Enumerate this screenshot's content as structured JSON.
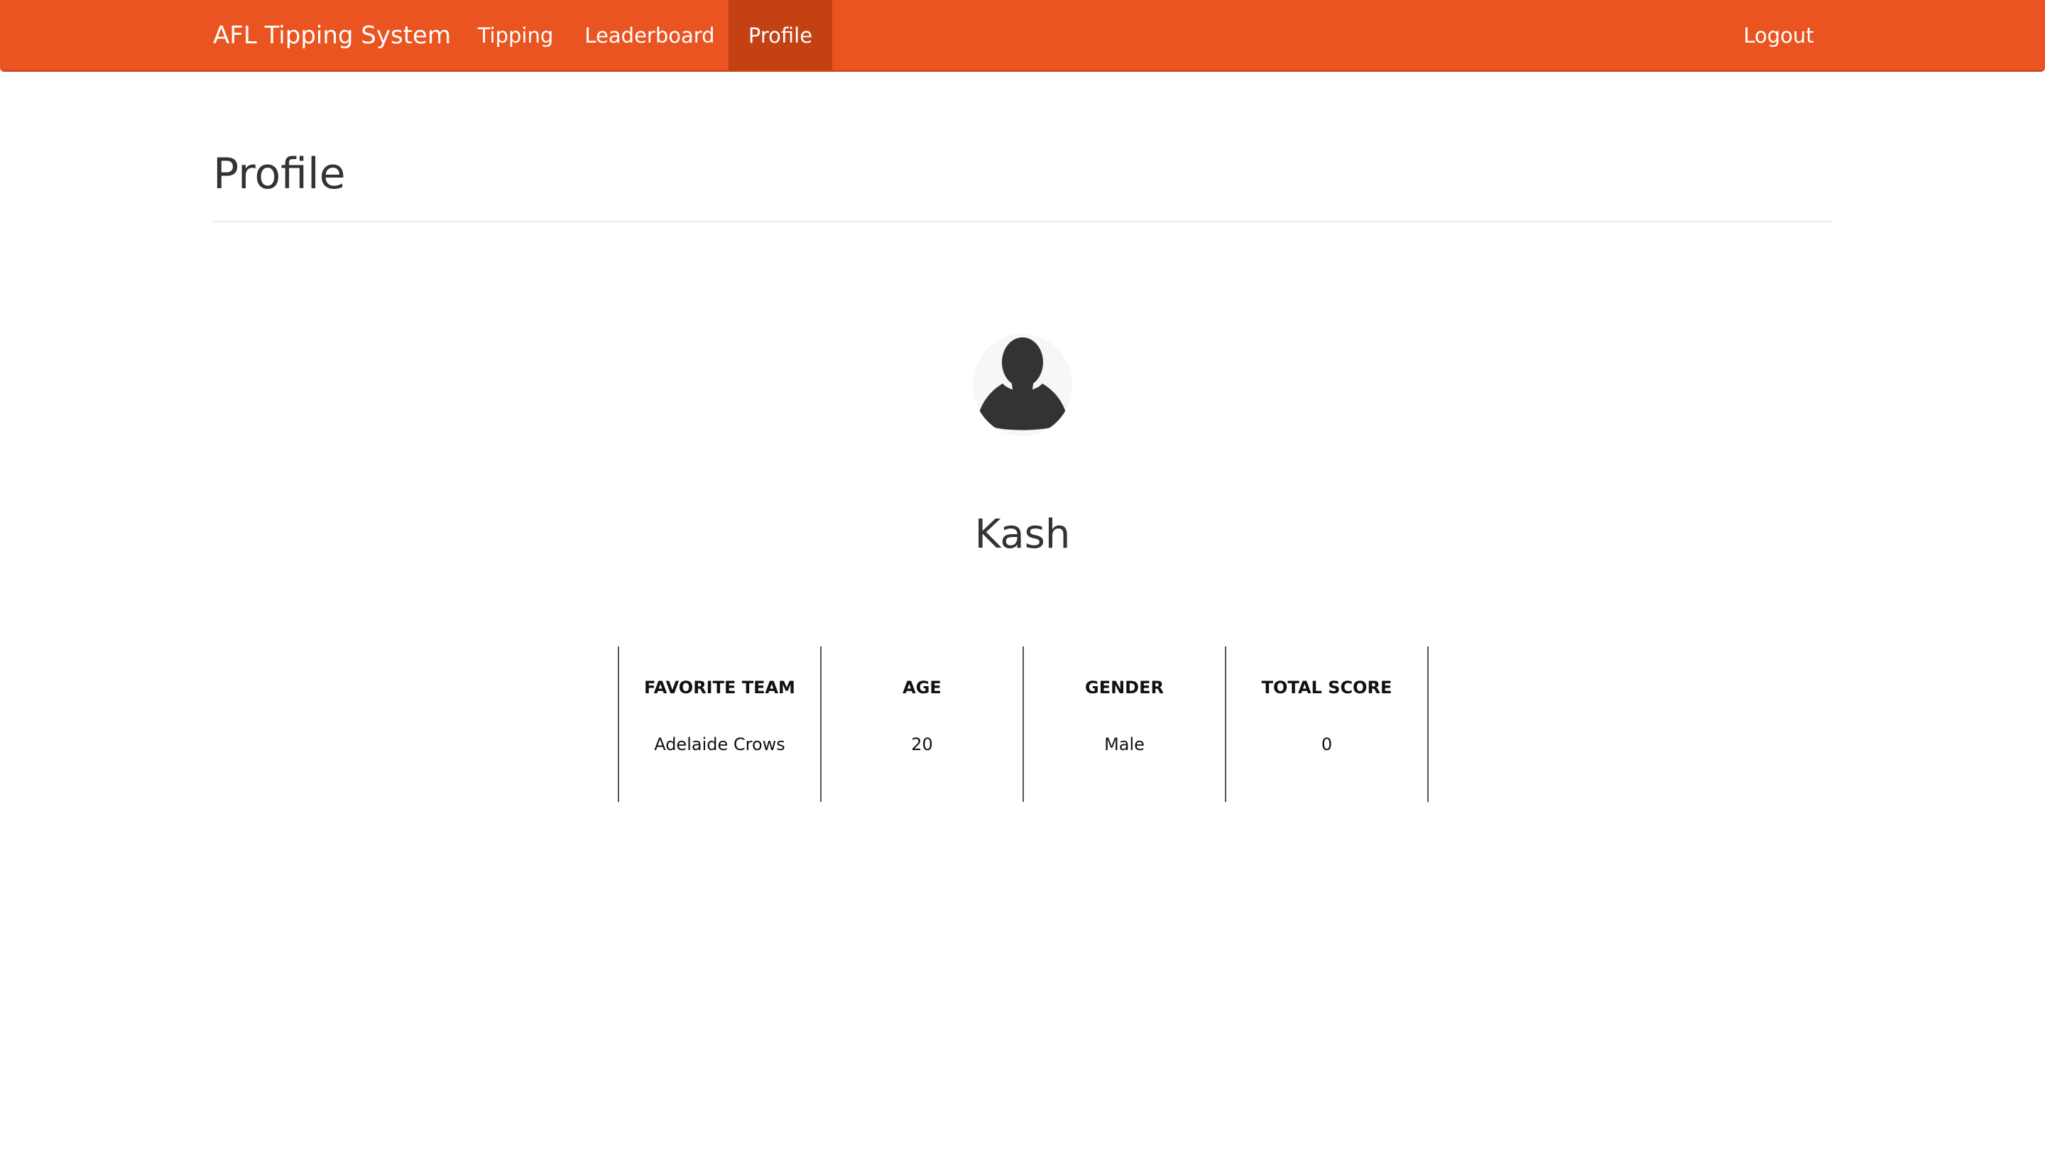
{
  "navbar": {
    "brand": "AFL Tipping System",
    "items": [
      {
        "label": "Tipping"
      },
      {
        "label": "Leaderboard"
      },
      {
        "label": "Profile",
        "active": true
      }
    ],
    "logout_label": "Logout",
    "color": "#e95420",
    "active_color": "#c34113"
  },
  "page": {
    "title": "Profile"
  },
  "profile": {
    "avatar_icon": "user-silhouette-icon",
    "username": "Kash",
    "columns": [
      "FAVORITE TEAM",
      "AGE",
      "GENDER",
      "TOTAL SCORE"
    ],
    "values": [
      "Adelaide Crows",
      "20",
      "Male",
      "0"
    ]
  }
}
